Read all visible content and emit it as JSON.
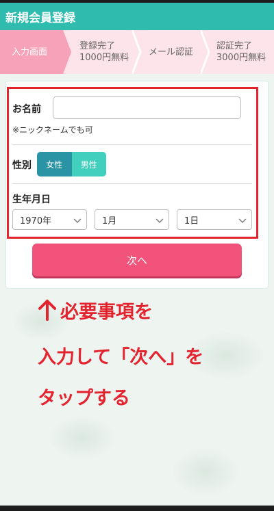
{
  "header": {
    "title": "新規会員登録"
  },
  "steps": [
    {
      "line1": "入力画面",
      "line2": ""
    },
    {
      "line1": "登録完了",
      "line2": "1000円無料"
    },
    {
      "line1": "メール認証",
      "line2": ""
    },
    {
      "line1": "認証完了",
      "line2": "3000円無料"
    }
  ],
  "form": {
    "name_label": "お名前",
    "name_value": "",
    "name_note": "※ニックネームでも可",
    "gender_label": "性別",
    "gender_options": [
      "女性",
      "男性"
    ],
    "birth_label": "生年月日",
    "year": "1970年",
    "month": "1月",
    "day": "1日",
    "next_label": "次へ"
  },
  "annotation": {
    "line1": "必要事項を",
    "line2": "入力して「次へ」を",
    "line3": "タップする"
  },
  "colors": {
    "header": "#2fbcae",
    "step_active": "#f6a2b9",
    "step_bg": "#fde3ea",
    "next_button": "#f1537a",
    "highlight": "#e3232e",
    "gender_selected": "#2a93a4",
    "gender_unselected": "#42cfbd"
  }
}
